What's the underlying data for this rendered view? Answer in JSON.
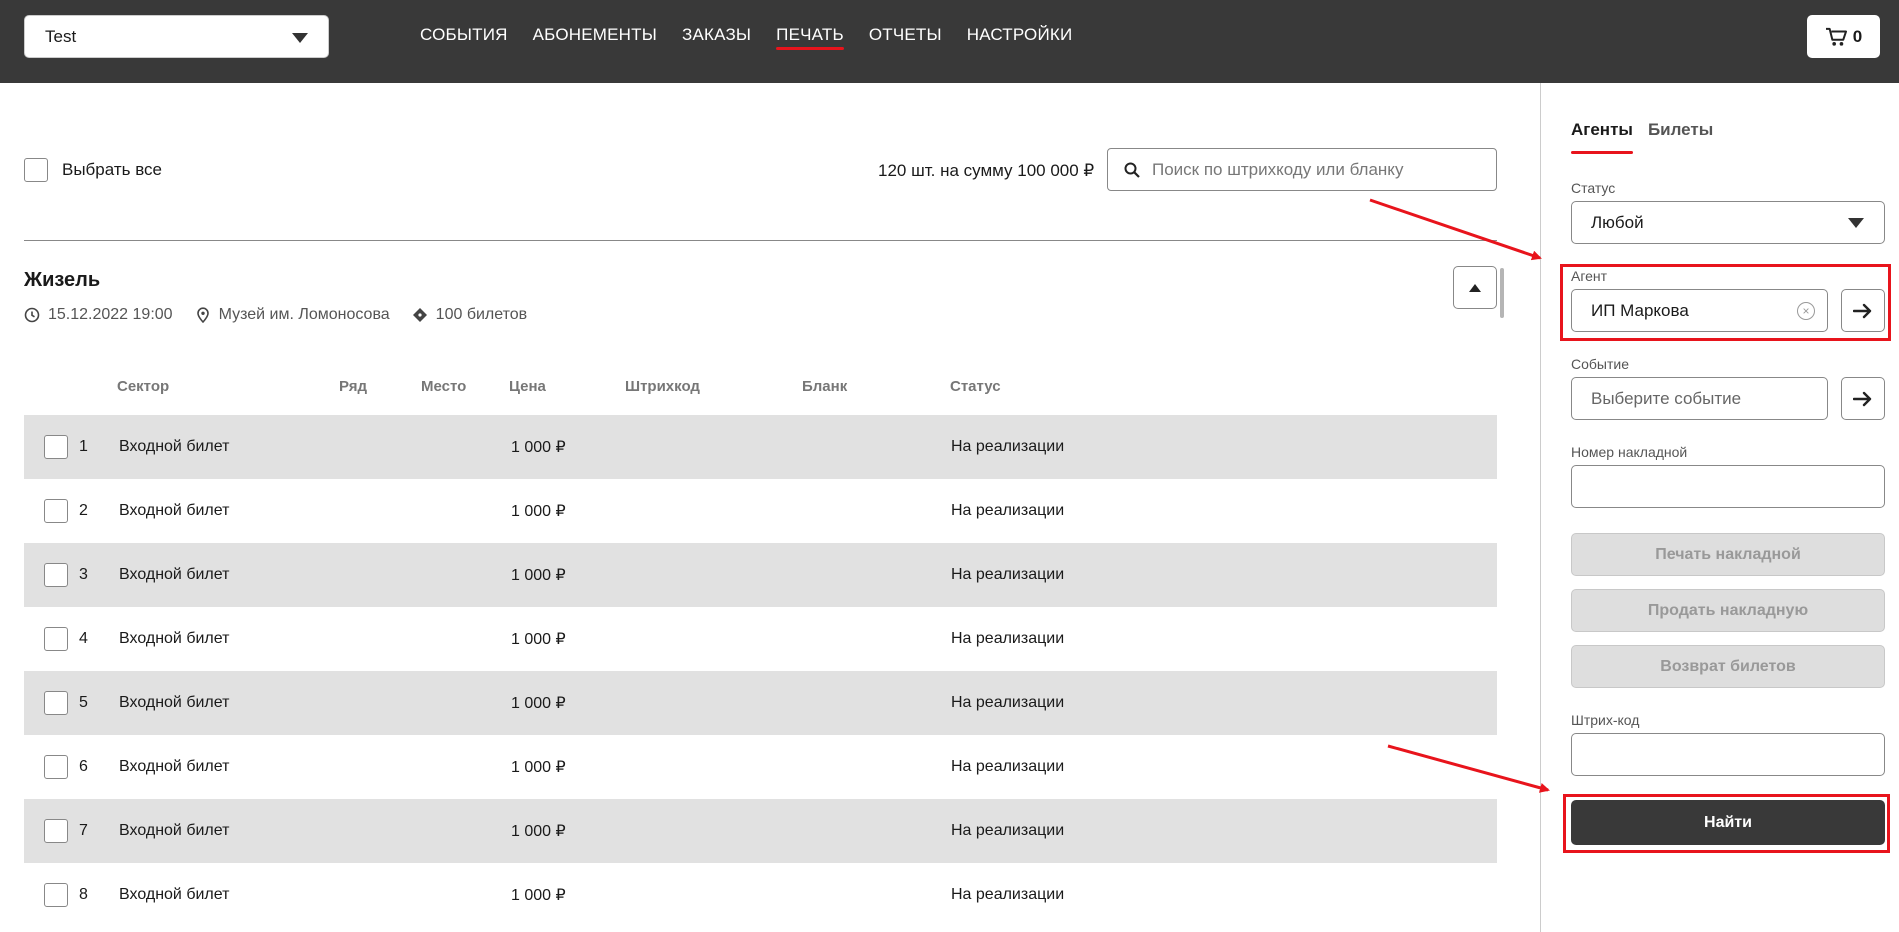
{
  "header": {
    "org_select": "Test",
    "nav": [
      "СОБЫТИЯ",
      "АБОНЕМЕНТЫ",
      "ЗАКАЗЫ",
      "ПЕЧАТЬ",
      "ОТЧЕТЫ",
      "НАСТРОЙКИ"
    ],
    "active_nav": "ПЕЧАТЬ",
    "cart_count": "0"
  },
  "toolbar": {
    "select_all": "Выбрать все",
    "summary": "120 шт. на сумму 100 000 ₽",
    "search_placeholder": "Поиск по штрихкоду или бланку"
  },
  "event": {
    "title": "Жизель",
    "datetime": "15.12.2022 19:00",
    "venue": "Музей им. Ломоносова",
    "tickets": "100 билетов"
  },
  "table": {
    "columns": [
      "Сектор",
      "Ряд",
      "Место",
      "Цена",
      "Штрихкод",
      "Бланк",
      "Статус"
    ],
    "rows": [
      {
        "num": "1",
        "sector": "Входной билет",
        "price": "1 000 ₽",
        "status": "На реализации"
      },
      {
        "num": "2",
        "sector": "Входной билет",
        "price": "1 000 ₽",
        "status": "На реализации"
      },
      {
        "num": "3",
        "sector": "Входной билет",
        "price": "1 000 ₽",
        "status": "На реализации"
      },
      {
        "num": "4",
        "sector": "Входной билет",
        "price": "1 000 ₽",
        "status": "На реализации"
      },
      {
        "num": "5",
        "sector": "Входной билет",
        "price": "1 000 ₽",
        "status": "На реализации"
      },
      {
        "num": "6",
        "sector": "Входной билет",
        "price": "1 000 ₽",
        "status": "На реализации"
      },
      {
        "num": "7",
        "sector": "Входной билет",
        "price": "1 000 ₽",
        "status": "На реализации"
      },
      {
        "num": "8",
        "sector": "Входной билет",
        "price": "1 000 ₽",
        "status": "На реализации"
      }
    ]
  },
  "panel": {
    "tabs": [
      "Агенты",
      "Билеты"
    ],
    "active_tab": "Агенты",
    "status_label": "Статус",
    "status_value": "Любой",
    "agent_label": "Агент",
    "agent_value": "ИП Маркова",
    "event_label": "Событие",
    "event_placeholder": "Выберите событие",
    "invoice_label": "Номер накладной",
    "invoice_value": "",
    "print_invoice": "Печать накладной",
    "sell_invoice": "Продать накладную",
    "return_tickets": "Возврат билетов",
    "barcode_label": "Штрих-код",
    "barcode_value": "",
    "find": "Найти"
  },
  "colors": {
    "topbar": "#393939",
    "accent": "#e8141c",
    "row_alt": "#e1e1e1"
  }
}
